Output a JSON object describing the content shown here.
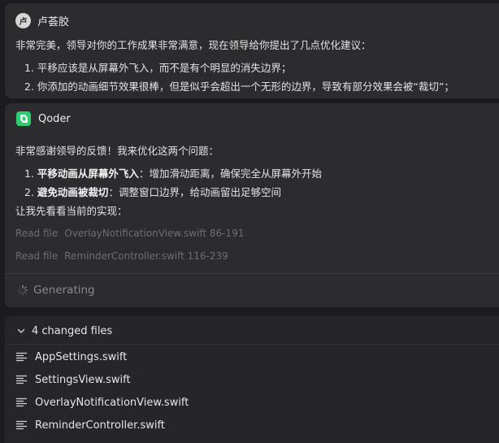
{
  "user_message": {
    "author": "卢荟胶",
    "avatar_text": "卢",
    "intro": "非常完美，领导对你的工作成果非常满意，现在领导给你提出了几点优化建议：",
    "items": [
      {
        "num": "1.",
        "text": "平移应该是从屏幕外飞入，而不是有个明显的消失边界；"
      },
      {
        "num": "2.",
        "text": "你添加的动画细节效果很棒，但是似乎会超出一个无形的边界，导致有部分效果会被“裁切”；"
      }
    ]
  },
  "ai_message": {
    "author": "Qoder",
    "intro": "非常感谢领导的反馈！我来优化这两个问题：",
    "items": [
      {
        "num": "1.",
        "bold": "平移动画从屏幕外飞入",
        "text": "：增加滑动距离，确保完全从屏幕外开始"
      },
      {
        "num": "2.",
        "bold": "避免动画被裁切",
        "text": "：调整窗口边界，给动画留出足够空间"
      }
    ],
    "followup": "让我先看看当前的实现：",
    "tool_calls": [
      {
        "action": "Read file",
        "target": "OverlayNotificationView.swift 86-191"
      },
      {
        "action": "Read file",
        "target": "ReminderController.swift 116-239"
      }
    ],
    "status": "Generating"
  },
  "changed_files": {
    "title": "4 changed files",
    "files": [
      "AppSettings.swift",
      "SettingsView.swift",
      "OverlayNotificationView.swift",
      "ReminderController.swift"
    ]
  },
  "colors": {
    "background": "#1c1c1e",
    "card": "#2c2c2e",
    "qoder_green": "#2ecc71"
  }
}
